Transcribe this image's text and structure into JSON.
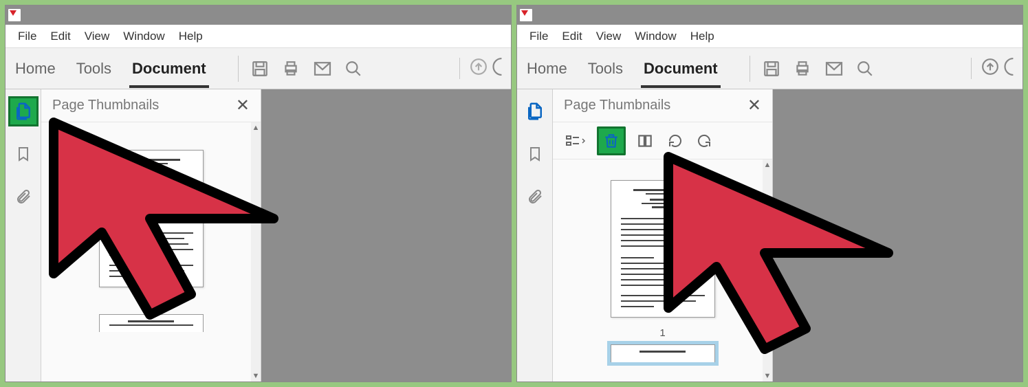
{
  "menu": {
    "file": "File",
    "edit": "Edit",
    "view": "View",
    "window": "Window",
    "help": "Help"
  },
  "tabs": {
    "home": "Home",
    "tools": "Tools",
    "document": "Document"
  },
  "panel": {
    "title": "Page Thumbnails"
  },
  "thumbs": {
    "page1_label": "1"
  }
}
